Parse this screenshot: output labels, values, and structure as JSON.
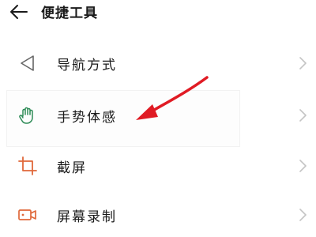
{
  "header": {
    "back_icon": "arrow-left-icon",
    "title": "便捷工具"
  },
  "items": [
    {
      "label": "导航方式",
      "icon": "navigation-back-triangle-icon",
      "chevron": "chevron-right-icon"
    },
    {
      "label": "手势体感",
      "icon": "hand-gesture-icon",
      "chevron": "chevron-right-icon"
    },
    {
      "label": "截屏",
      "icon": "crop-icon",
      "chevron": "chevron-right-icon"
    },
    {
      "label": "屏幕录制",
      "icon": "video-camera-icon",
      "chevron": "chevron-right-icon"
    }
  ],
  "colors": {
    "icon_gray": "#666666",
    "icon_green": "#2e8b57",
    "icon_orange": "#e0683a",
    "chevron": "#c4c4c4",
    "annotation_arrow": "#e01b24"
  }
}
